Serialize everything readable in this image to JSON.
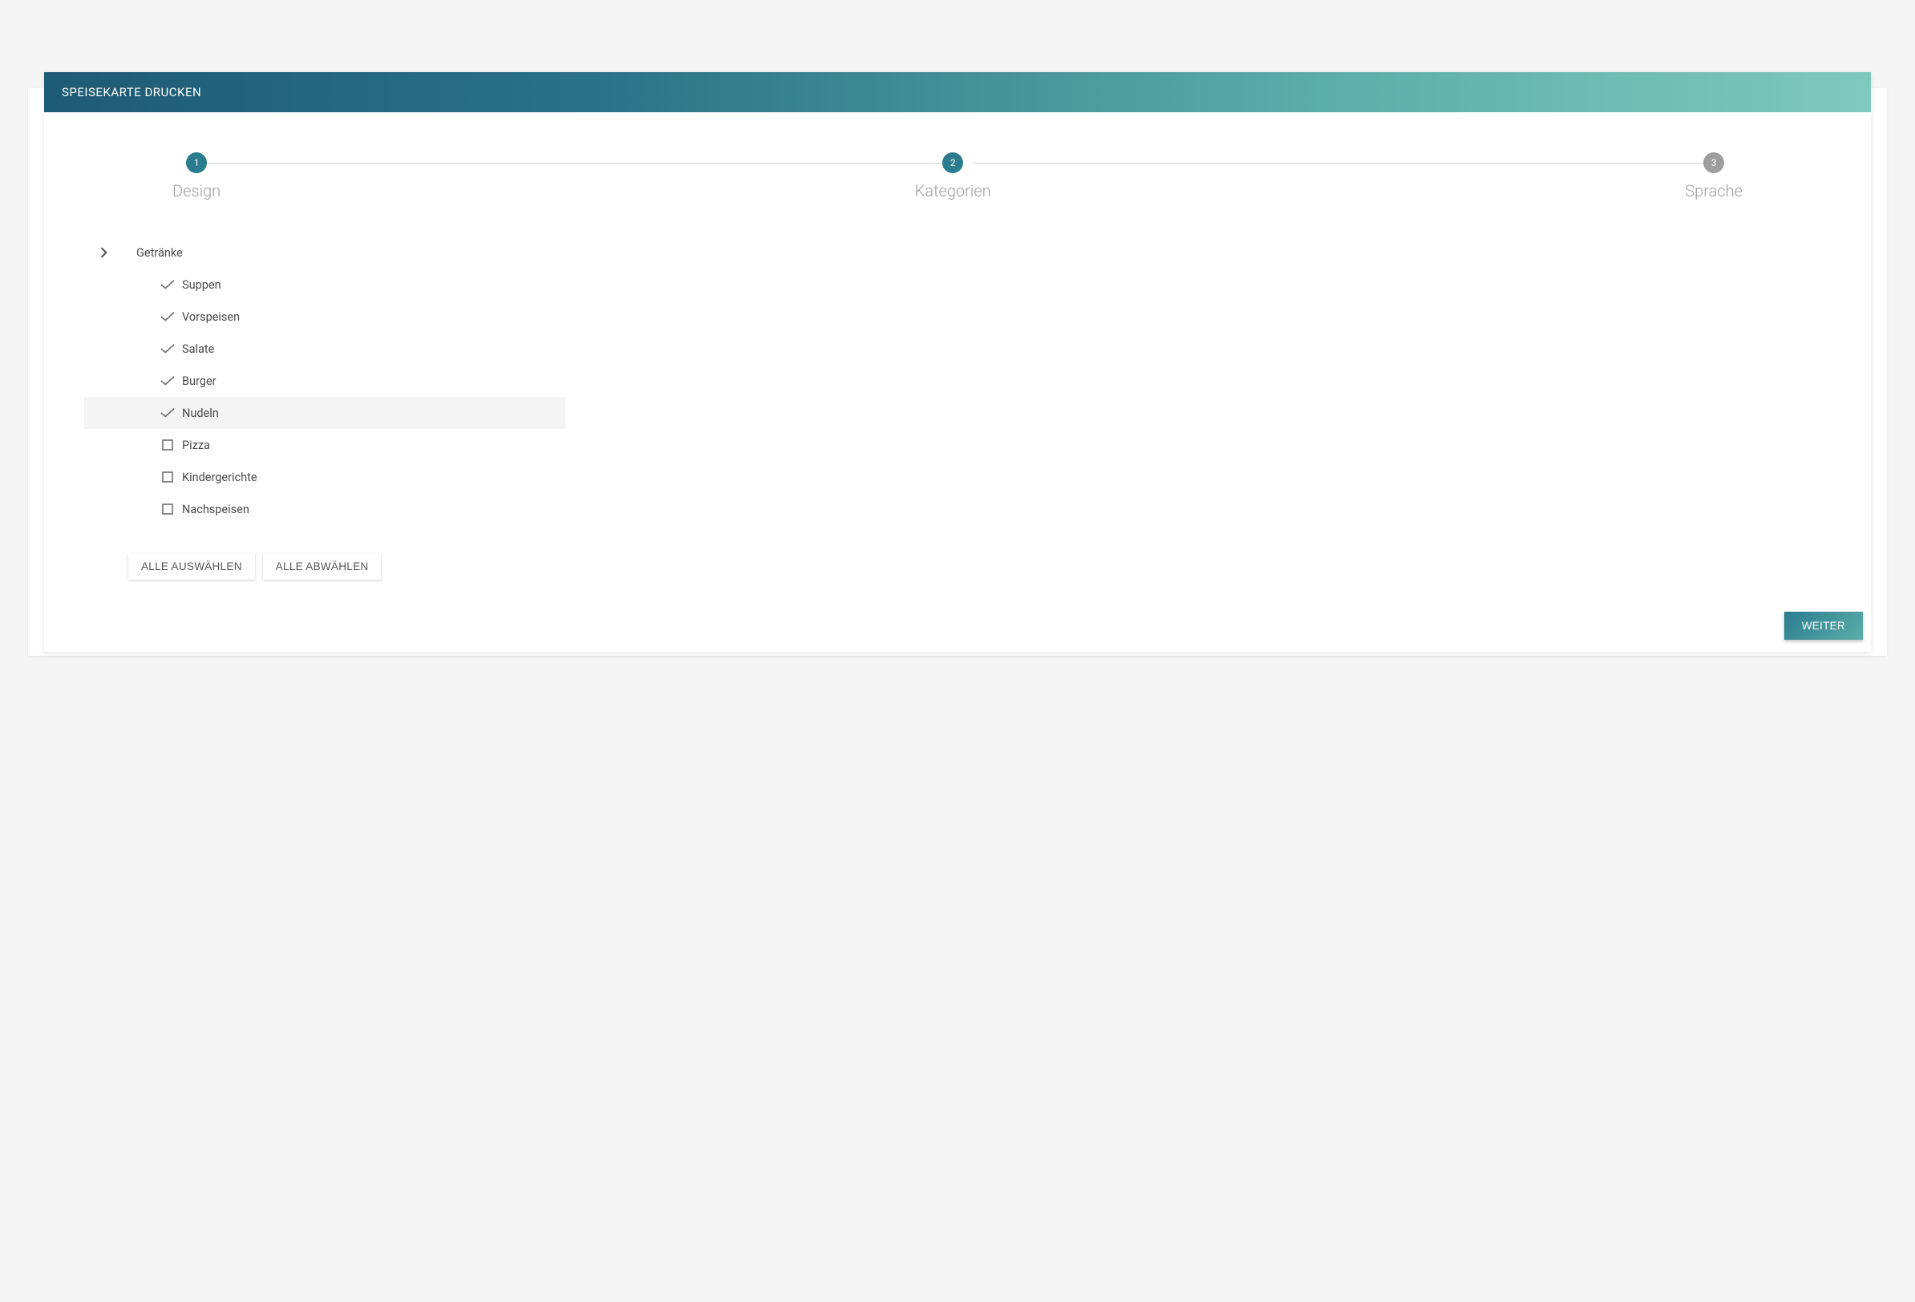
{
  "header": {
    "title": "SPEISEKARTE DRUCKEN"
  },
  "stepper": {
    "steps": [
      {
        "number": "1",
        "label": "Design",
        "state": "active"
      },
      {
        "number": "2",
        "label": "Kategorien",
        "state": "active"
      },
      {
        "number": "3",
        "label": "Sprache",
        "state": "inactive"
      }
    ]
  },
  "categories": {
    "parent": "Getränke",
    "items": [
      {
        "label": "Suppen",
        "checked": true,
        "hover": false
      },
      {
        "label": "Vorspeisen",
        "checked": true,
        "hover": false
      },
      {
        "label": "Salate",
        "checked": true,
        "hover": false
      },
      {
        "label": "Burger",
        "checked": true,
        "hover": false
      },
      {
        "label": "Nudeln",
        "checked": true,
        "hover": true
      },
      {
        "label": "Pizza",
        "checked": false,
        "hover": false
      },
      {
        "label": "Kindergerichte",
        "checked": false,
        "hover": false
      },
      {
        "label": "Nachspeisen",
        "checked": false,
        "hover": false
      }
    ]
  },
  "actions": {
    "select_all": "ALLE AUSWÄHLEN",
    "deselect_all": "ALLE ABWÄHLEN",
    "next": "WEITER"
  }
}
